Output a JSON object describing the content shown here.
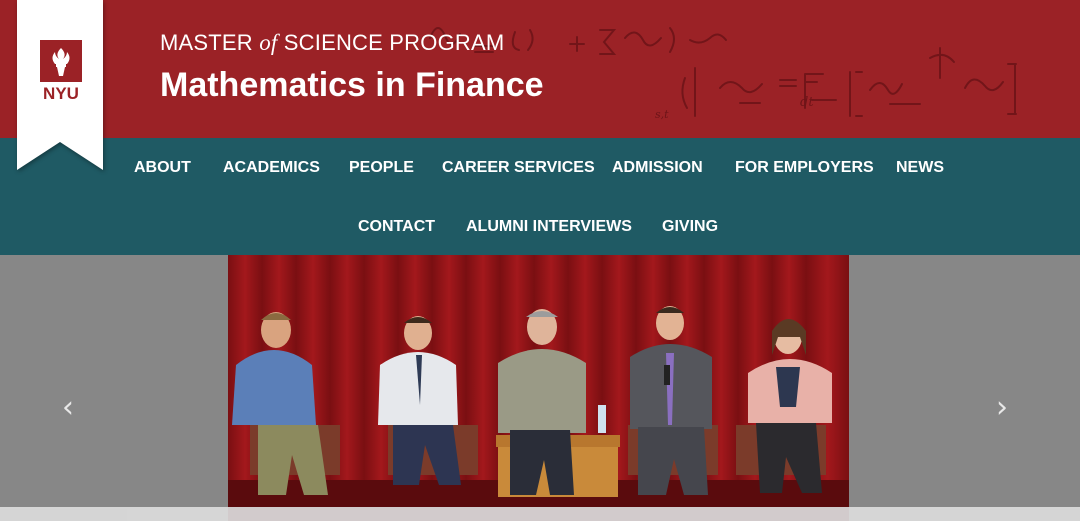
{
  "header": {
    "subtitle_pre": "MASTER ",
    "subtitle_of": "of",
    "subtitle_post": " SCIENCE PROGRAM",
    "title": "Mathematics in Finance"
  },
  "logo": {
    "text": "NYU",
    "color": "#9b2226"
  },
  "nav": {
    "items": [
      {
        "label": "ABOUT"
      },
      {
        "label": "ACADEMICS"
      },
      {
        "label": "PEOPLE"
      },
      {
        "label": "CAREER SERVICES"
      },
      {
        "label": "ADMISSION"
      },
      {
        "label": "FOR EMPLOYERS"
      },
      {
        "label": "NEWS"
      },
      {
        "label": "CONTACT"
      },
      {
        "label": "ALUMNI INTERVIEWS"
      },
      {
        "label": "GIVING"
      }
    ]
  },
  "carousel": {
    "prev_icon": "chevron-left-icon",
    "next_icon": "chevron-right-icon",
    "caption": ""
  },
  "colors": {
    "header_bg": "#9b2226",
    "nav_bg": "#1f5a64",
    "carousel_bg": "#878787"
  }
}
